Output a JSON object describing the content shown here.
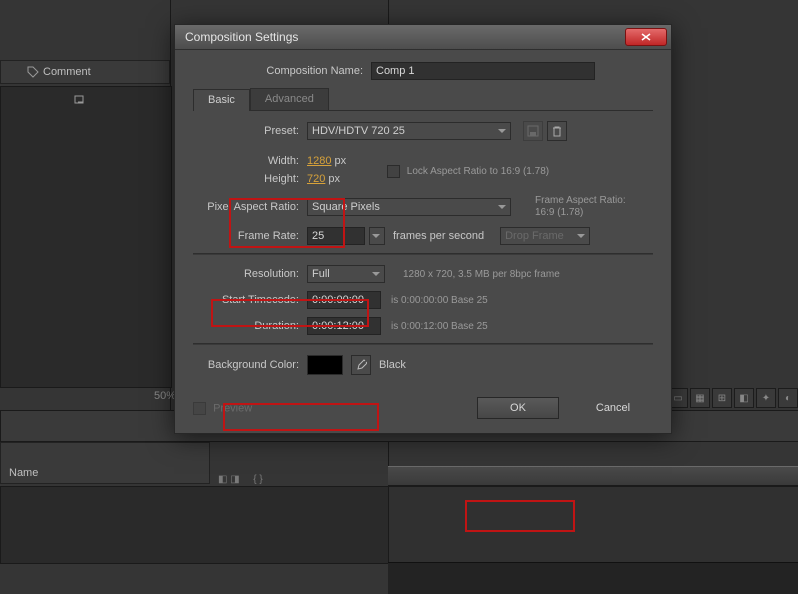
{
  "bg": {
    "comment_header": "Comment",
    "name_header": "Name",
    "zoom": "50%",
    "toggle1": "◧ ◨",
    "toggle2": "{ }"
  },
  "dialog": {
    "title": "Composition Settings",
    "name_label": "Composition Name:",
    "name_value": "Comp 1",
    "tabs": {
      "basic": "Basic",
      "advanced": "Advanced"
    },
    "preset_label": "Preset:",
    "preset_value": "HDV/HDTV 720 25",
    "width_label": "Width:",
    "width_value": "1280",
    "width_unit": "px",
    "height_label": "Height:",
    "height_value": "720",
    "height_unit": "px",
    "lock_label": "Lock Aspect Ratio to 16:9 (1.78)",
    "par_label": "Pixel Aspect Ratio:",
    "par_value": "Square Pixels",
    "far_label": "Frame Aspect Ratio:",
    "far_value": "16:9 (1.78)",
    "fps_label": "Frame Rate:",
    "fps_value": "25",
    "fps_unit": "frames per second",
    "drop_value": "Drop Frame",
    "res_label": "Resolution:",
    "res_value": "Full",
    "res_info": "1280 x 720, 3.5 MB per 8bpc frame",
    "start_label": "Start Timecode:",
    "start_value": "0:00:00:00",
    "start_info": "is 0:00:00:00  Base 25",
    "dur_label": "Duration:",
    "dur_value": "0:00:12:00",
    "dur_info": "is 0:00:12:00  Base 25",
    "bg_label": "Background Color:",
    "bg_name": "Black",
    "preview": "Preview",
    "ok": "OK",
    "cancel": "Cancel"
  }
}
